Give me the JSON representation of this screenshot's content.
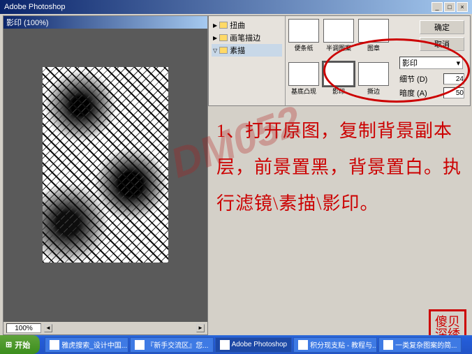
{
  "window": {
    "title": "Adobe Photoshop",
    "min": "_",
    "max": "□",
    "close": "×"
  },
  "document": {
    "title": "影印 (100%)",
    "zoom": "100%"
  },
  "watermark": "DM052",
  "filter_groups": {
    "items": [
      {
        "label": "扭曲"
      },
      {
        "label": "画笔描边"
      },
      {
        "label": "素描"
      }
    ]
  },
  "thumbnails": [
    {
      "label": "便条纸"
    },
    {
      "label": "半调图案"
    },
    {
      "label": "图章"
    },
    {
      "label": "基底凸现"
    },
    {
      "label": "影印"
    },
    {
      "label": "撕边"
    }
  ],
  "settings": {
    "ok": "确定",
    "cancel": "取消",
    "filter_name": "影印",
    "param1_label": "细节 (D)",
    "param1_value": "24",
    "param2_label": "暗度 (A)",
    "param2_value": "50"
  },
  "instruction_text": "1、打开原图，复制背景副本层，前景置黑，背景置白。执行滤镜\\素描\\影印。",
  "seal": "傻贝\n深绣",
  "taskbar": {
    "start": "开始",
    "items": [
      "雅虎搜索_设计中国...",
      "『新手交流区』您...",
      "Adobe Photoshop",
      "积分现支贴 - 教程与...",
      "一类复杂图案的简..."
    ]
  }
}
